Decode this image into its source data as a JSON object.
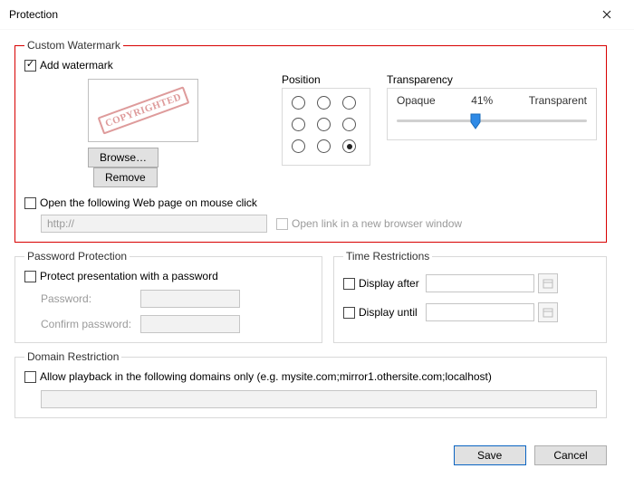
{
  "title": "Protection",
  "watermark": {
    "legend": "Custom Watermark",
    "add_label": "Add watermark",
    "add_checked": true,
    "preview_text": "COPYRIGHTED",
    "browse_label": "Browse…",
    "remove_label": "Remove",
    "position_label": "Position",
    "position_selected": "bottom-right",
    "transparency_label": "Transparency",
    "opaque_label": "Opaque",
    "transparency_value": "41%",
    "transparency_percent": 41,
    "transparent_label": "Transparent",
    "open_web_label": "Open the following Web page on mouse click",
    "open_web_checked": false,
    "url_value": "http://",
    "new_window_label": "Open link in a new browser window",
    "new_window_checked": false
  },
  "password": {
    "legend": "Password Protection",
    "protect_label": "Protect presentation with a password",
    "protect_checked": false,
    "password_label": "Password:",
    "confirm_label": "Confirm password:"
  },
  "time": {
    "legend": "Time Restrictions",
    "after_label": "Display after",
    "after_checked": false,
    "until_label": "Display until",
    "until_checked": false
  },
  "domain": {
    "legend": "Domain Restriction",
    "allow_label": "Allow playback in the following domains only (e.g. mysite.com;mirror1.othersite.com;localhost)",
    "allow_checked": false
  },
  "footer": {
    "save_label": "Save",
    "cancel_label": "Cancel"
  }
}
